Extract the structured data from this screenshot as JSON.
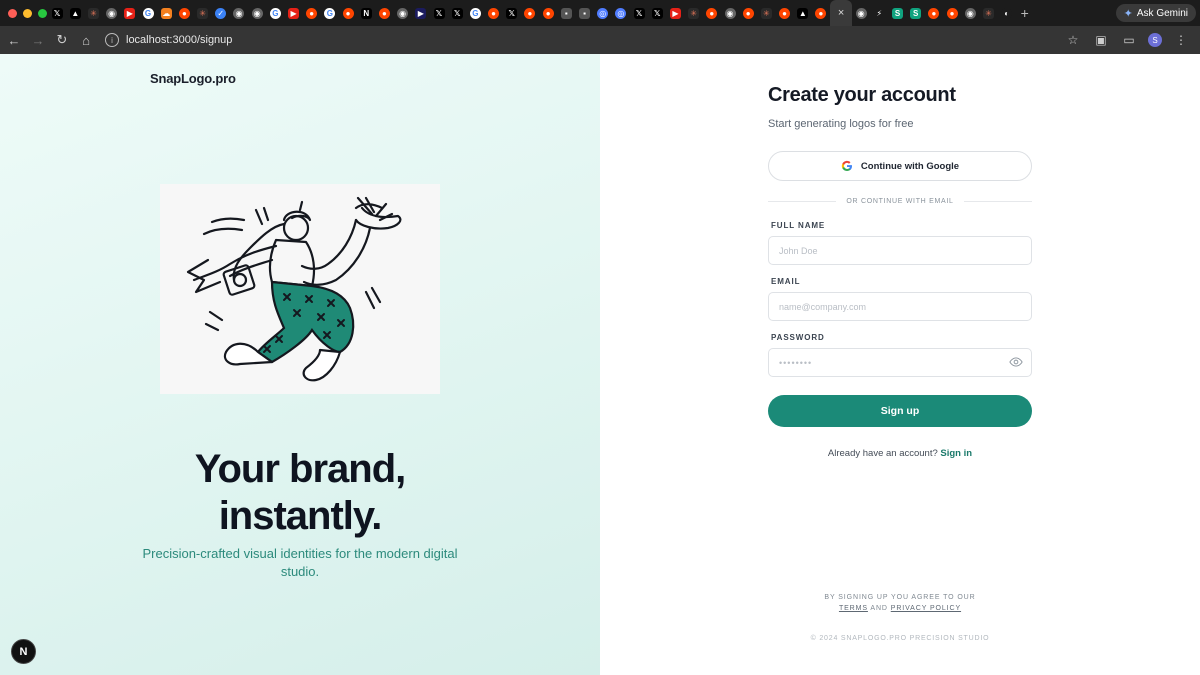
{
  "browser": {
    "tab_icons": [
      "x",
      "triangle",
      "spark",
      "globe",
      "youtube",
      "google-g",
      "flame",
      "reddit",
      "spark",
      "check",
      "globe",
      "globe",
      "google",
      "youtube",
      "reddit",
      "google",
      "reddit",
      "netflix",
      "reddit",
      "globe",
      "play",
      "x",
      "x",
      "google",
      "reddit",
      "x",
      "reddit",
      "reddit",
      "square",
      "square",
      "circle",
      "circle",
      "x",
      "x",
      "youtube",
      "spark",
      "reddit",
      "globe",
      "reddit",
      "spark",
      "reddit",
      "triangle",
      "reddit"
    ],
    "active_tab_close": "×",
    "new_tab": "+",
    "right_tab_icons": [
      "globe",
      "bolt",
      "s-logo",
      "s-logo",
      "reddit",
      "reddit",
      "globe",
      "spark",
      "github"
    ],
    "gemini_label": "Ask Gemini",
    "url": "localhost:3000/signup",
    "profile_initial": "S"
  },
  "left_panel": {
    "brand": "SnapLogo.pro",
    "hero_line1": "Your brand,",
    "hero_line2": "instantly.",
    "hero_sub": "Precision-crafted visual identities for the modern digital studio.",
    "badge": "N"
  },
  "signup": {
    "title": "Create your account",
    "subtitle": "Start generating logos for free",
    "google_label": "Continue with Google",
    "divider_text": "OR CONTINUE WITH EMAIL",
    "full_name_label": "FULL NAME",
    "full_name_placeholder": "John Doe",
    "email_label": "EMAIL",
    "email_placeholder": "name@company.com",
    "password_label": "PASSWORD",
    "password_placeholder": "••••••••",
    "submit_label": "Sign up",
    "have_account": "Already have an account?",
    "sign_in": "Sign in"
  },
  "footer": {
    "agree_line": "BY SIGNING UP YOU AGREE TO OUR",
    "terms": "TERMS",
    "and": "AND",
    "privacy": "PRIVACY POLICY",
    "copyright": "© 2024 SNAPLOGO.PRO PRECISION STUDIO"
  },
  "colors": {
    "accent": "#1b8a78",
    "accent_text": "#2c8a7c",
    "left_bg": "#e3f6f2",
    "chrome_dark": "#1c1c1c"
  }
}
